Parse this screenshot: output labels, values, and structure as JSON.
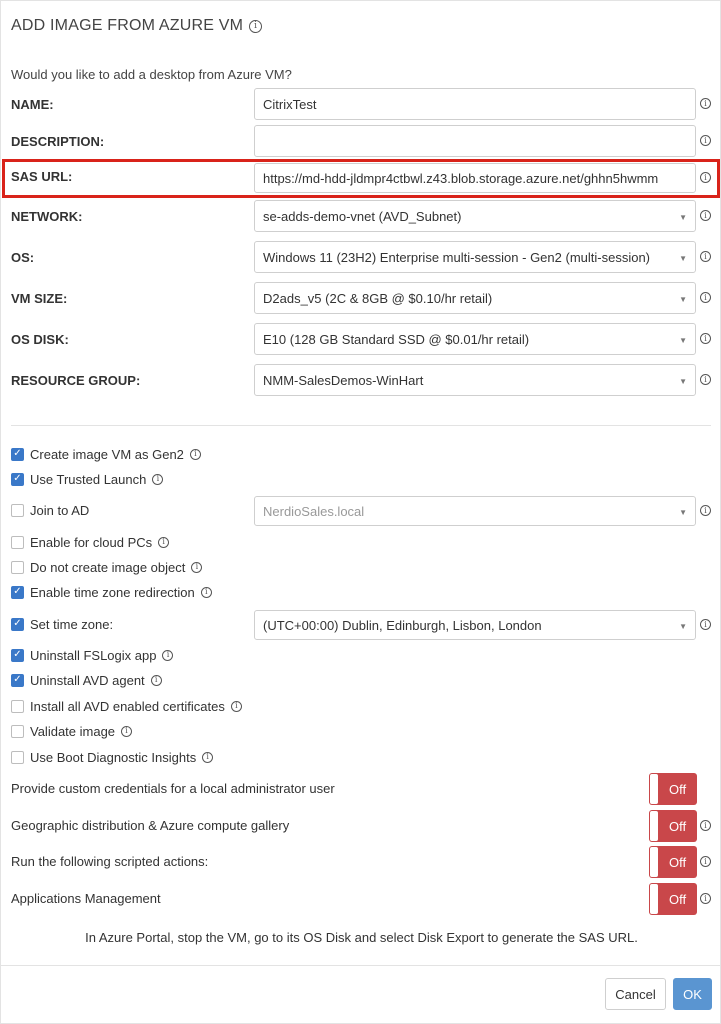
{
  "dialog": {
    "title": "ADD IMAGE FROM AZURE VM",
    "subtitle": "Would you like to add a desktop from Azure VM?"
  },
  "form": {
    "name": {
      "label": "NAME:",
      "value": "CitrixTest"
    },
    "description": {
      "label": "DESCRIPTION:",
      "value": ""
    },
    "sas_url": {
      "label": "SAS URL:",
      "value": "https://md-hdd-jldmpr4ctbwl.z43.blob.storage.azure.net/ghhn5hwmm"
    },
    "network": {
      "label": "NETWORK:",
      "value": "se-adds-demo-vnet (AVD_Subnet)"
    },
    "os": {
      "label": "OS:",
      "value": "Windows 11 (23H2) Enterprise multi-session - Gen2 (multi-session)"
    },
    "vm_size": {
      "label": "VM SIZE:",
      "value": "D2ads_v5 (2C & 8GB @ $0.10/hr retail)"
    },
    "os_disk": {
      "label": "OS DISK:",
      "value": "E10 (128 GB Standard SSD @ $0.01/hr retail)"
    },
    "resource_group": {
      "label": "RESOURCE GROUP:",
      "value": "NMM-SalesDemos-WinHart"
    }
  },
  "options": {
    "gen2": {
      "label": "Create image VM as Gen2",
      "checked": true
    },
    "trusted_launch": {
      "label": "Use Trusted Launch",
      "checked": true
    },
    "join_ad": {
      "label": "Join to AD",
      "checked": false,
      "domain": "NerdioSales.local"
    },
    "cloud_pcs": {
      "label": "Enable for cloud PCs",
      "checked": false
    },
    "no_image_object": {
      "label": "Do not create image object",
      "checked": false
    },
    "tz_redirection": {
      "label": "Enable time zone redirection",
      "checked": true
    },
    "set_timezone": {
      "label": "Set time zone:",
      "checked": true,
      "value": "(UTC+00:00) Dublin, Edinburgh, Lisbon, London"
    },
    "uninstall_fslogix": {
      "label": "Uninstall FSLogix app",
      "checked": true
    },
    "uninstall_avd_agent": {
      "label": "Uninstall AVD agent",
      "checked": true
    },
    "avd_certificates": {
      "label": "Install all AVD enabled certificates",
      "checked": false
    },
    "validate_image": {
      "label": "Validate image",
      "checked": false
    },
    "boot_diagnostics": {
      "label": "Use Boot Diagnostic Insights",
      "checked": false
    }
  },
  "toggles": {
    "custom_credentials": {
      "label": "Provide custom credentials for a local administrator user",
      "state": "Off"
    },
    "geo_distribution": {
      "label": "Geographic distribution & Azure compute gallery",
      "state": "Off"
    },
    "scripted_actions": {
      "label": "Run the following scripted actions:",
      "state": "Off"
    },
    "apps_management": {
      "label": "Applications Management",
      "state": "Off"
    }
  },
  "note": "In Azure Portal, stop the VM, go to its OS Disk and select Disk Export to generate the SAS URL.",
  "buttons": {
    "cancel": "Cancel",
    "ok": "OK"
  },
  "colors": {
    "highlight": "#d9231a",
    "checkbox": "#3a78c8",
    "toggle_off": "#c9474a",
    "ok_button": "#5a95d1"
  },
  "icons": {
    "info": "info-circle-icon",
    "caret": "caret-down-icon",
    "check": "checkmark-icon"
  }
}
